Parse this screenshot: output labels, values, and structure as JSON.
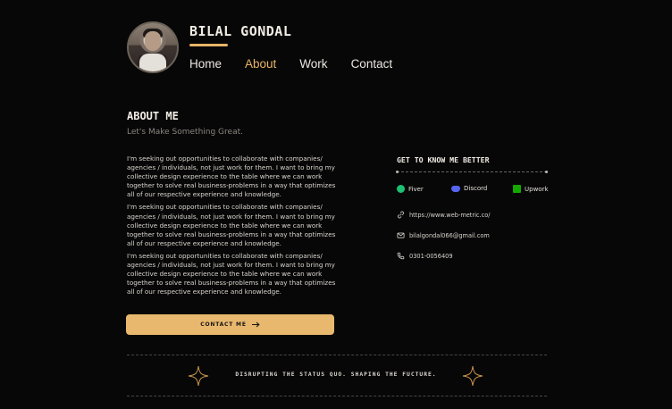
{
  "header": {
    "brand": "BILAL GONDAL",
    "nav": [
      {
        "label": "Home"
      },
      {
        "label": "About",
        "active": true
      },
      {
        "label": "Work"
      },
      {
        "label": "Contact"
      }
    ]
  },
  "about": {
    "title": "ABOUT ME",
    "subtitle": "Let's Make Something Great.",
    "paragraphs": [
      "I'm seeking out opportunities to collaborate with companies/ agencies / individuals, not just work for them. I want to bring my collective design experience to the table where we can work together to solve real business-problems in a way that optimizes all of our respective experience and knowledge.",
      "I'm seeking out opportunities to collaborate with companies/ agencies / individuals, not just work for them. I want to bring my collective design experience to the table where we can work together to solve real business-problems in a way that optimizes all of our respective experience and knowledge.",
      "I'm seeking out opportunities to collaborate with companies/ agencies / individuals, not just work for them. I want to bring my collective design experience to the table where we can work together to solve real business-problems in a way that optimizes all of our respective experience and knowledge."
    ],
    "contact_button": "CONTACT ME"
  },
  "sidebar": {
    "title": "GET TO KNOW ME BETTER",
    "socials": [
      {
        "label": "Fiver",
        "icon": "fiverr-icon",
        "color": "#1dbf73"
      },
      {
        "label": "Discord",
        "icon": "discord-icon",
        "color": "#5865f2"
      },
      {
        "label": "Upwork",
        "icon": "upwork-icon",
        "color": "#14a800"
      }
    ],
    "website": "https://www.web-metric.co/",
    "email": "bilalgondal066@gmail.com",
    "phone": "0301-0056409"
  },
  "footer": {
    "tagline": "DISRUPTING THE STATUS QUO. SHAPING THE FUCTURE."
  },
  "colors": {
    "accent": "#e8b468",
    "background": "#070707"
  }
}
